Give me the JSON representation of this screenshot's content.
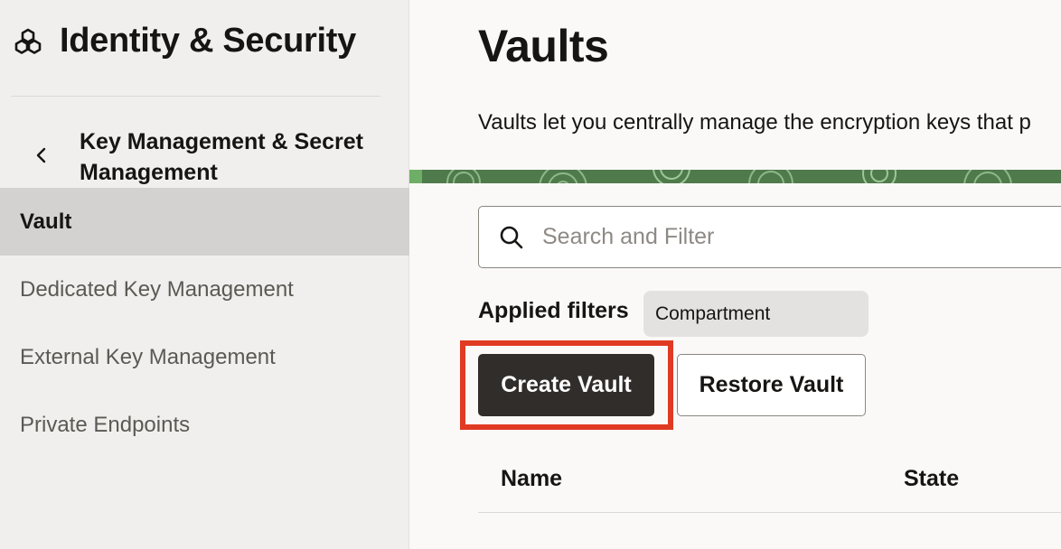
{
  "app": {
    "title": "Identity & Security",
    "logo_icon": "cubes-icon"
  },
  "sidebar": {
    "back_icon": "chevron-left-icon",
    "section_title": "Key Management & Secret Management",
    "items": [
      {
        "label": "Vault",
        "active": true
      },
      {
        "label": "Dedicated Key Management",
        "active": false
      },
      {
        "label": "External Key Management",
        "active": false
      },
      {
        "label": "Private Endpoints",
        "active": false
      }
    ]
  },
  "main": {
    "title": "Vaults",
    "description": "Vaults let you centrally manage the encryption keys that p",
    "search": {
      "placeholder": "Search and Filter",
      "value": ""
    },
    "filters": {
      "label": "Applied filters",
      "chips": [
        "Compartment"
      ]
    },
    "actions": {
      "create_label": "Create Vault",
      "restore_label": "Restore Vault"
    },
    "table": {
      "columns": [
        "Name",
        "State"
      ]
    }
  },
  "colors": {
    "primary_button": "#312d2a",
    "highlight": "#e03a23",
    "banner": "#4f7a4b",
    "sidebar_bg": "#f1efed",
    "active_nav_bg": "#d4d2d0"
  }
}
